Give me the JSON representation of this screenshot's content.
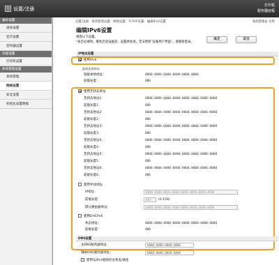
{
  "app": {
    "title": "设置/注册",
    "nav_top": "打印机",
    "nav_bottom": "服务器远程",
    "breadcrumb": "设置/注册：系统管理设置：网络设置：TCP/IP设置：编辑IPv6设置",
    "user": "系统管理员 名称"
  },
  "sidebar": {
    "sections": [
      {
        "heading": "偏好设置",
        "items": [
          {
            "label": "纸张设置"
          },
          {
            "label": "显示设置"
          },
          {
            "label": "定时器设置"
          }
        ]
      },
      {
        "heading": "功能设置",
        "items": [
          {
            "label": "打印机设置"
          }
        ]
      },
      {
        "heading": "系统管理设置",
        "items": [
          {
            "label": "系统管理"
          },
          {
            "label": "网络设置",
            "active": true
          },
          {
            "label": "安全设置"
          },
          {
            "label": "初始化设置数据"
          }
        ]
      }
    ]
  },
  "page": {
    "title": "编辑IPv6设置",
    "desc_line1": "更改以下设置。",
    "desc_line2": "*表示必填项。重新启动设备后，设置将生效。无法更新\"设备用户界面\"，请重新登录。",
    "ok_label": "确定",
    "cancel_label": "取消"
  },
  "ipv6": {
    "section_title": "IP地址设置",
    "use_ipv6_label": "使用IPv6",
    "link_local_subheader": "链接本地地址",
    "link_local_label": "链接本地地址：",
    "link_local_value": "0000:0000:0000:0000:0000:0000",
    "link_local_prefix_label": "前缀长度：",
    "link_local_prefix_value": "000",
    "stateless_label": "使用无状态地址",
    "stateless_items": [
      {
        "addr_label": "无状态地址1：",
        "addr_value": "0000:0000:0000:0000:0000:0000:0000:0000",
        "prefix_label": "前缀长度1：",
        "prefix_value": "000"
      },
      {
        "addr_label": "无状态地址2：",
        "addr_value": "0000:0000:0000:0000:0000:0000:0000:0000",
        "prefix_label": "前缀长度2：",
        "prefix_value": "000"
      },
      {
        "addr_label": "无状态地址3：",
        "addr_value": "0000:0000:0000:0000:0000:0000:0000:0000",
        "prefix_label": "前缀长度3：",
        "prefix_value": "000"
      },
      {
        "addr_label": "无状态地址4：",
        "addr_value": "0000:0000:0000:0000:0000:0000:0000:0000",
        "prefix_label": "前缀长度4：",
        "prefix_value": "000"
      },
      {
        "addr_label": "无状态地址5：",
        "addr_value": "0000:0000:0000:0000:0000:0000:0000:0000",
        "prefix_label": "前缀长度5：",
        "prefix_value": "000"
      },
      {
        "addr_label": "无状态地址6：",
        "addr_value": "0000:0000:0000:0000:0000:0000:0000:0000",
        "prefix_label": "前缀长度6：",
        "prefix_value": "000"
      }
    ],
    "manual_label": "使用手动地址",
    "manual_ip_label": "IP地址：",
    "manual_ip_placeholder": "0000:0000:0000:0000:0000:0000:0000:0000",
    "manual_prefix_label": "前缀长度：",
    "manual_prefix_value": "064",
    "manual_prefix_hint": "(0-128)",
    "manual_router_label": "默认路由器地址：",
    "manual_router_placeholder": "0000:0000:0000:0000:0000:0000:0000:0000",
    "dhcp_label": "使用DHCPv6",
    "dhcp_addr_label": "状态地址：",
    "dhcp_addr_value": "0000:0000:0000:0000:0000:0000:0000:0000",
    "dhcp_prefix_label": "前缀长度：",
    "dhcp_prefix_value": "000"
  },
  "dns": {
    "section_title": "DNS设置",
    "primary_label": "主DNS服务器地址：",
    "primary_value": "0000:0000:0000:0000",
    "secondary_label": "辅助DNS服务器地址：",
    "secondary_value": "0000:0000:0000:0000",
    "same_host_label": "使用与IPv4相同的主机名/域名"
  }
}
